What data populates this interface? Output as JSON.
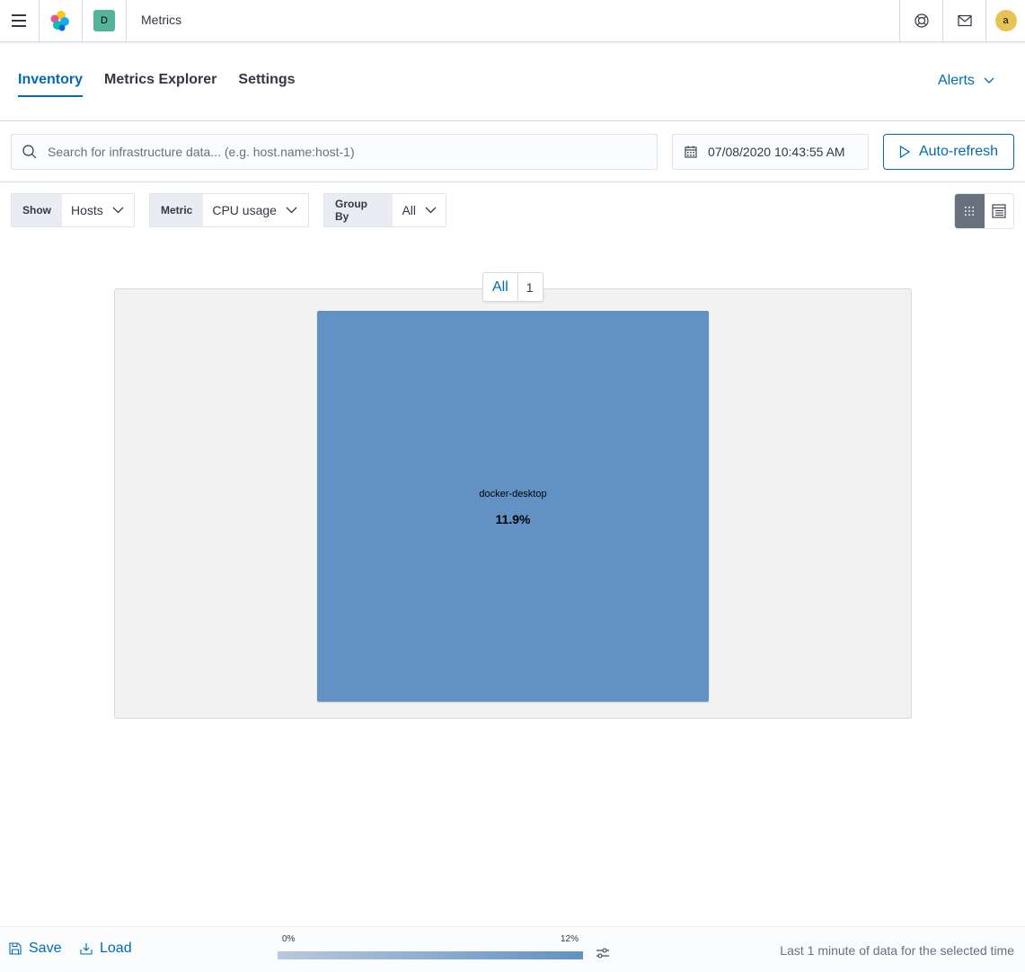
{
  "header": {
    "app_title": "Metrics",
    "space_initial": "D",
    "user_initial": "a",
    "icons": [
      "menu-icon",
      "elastic-logo",
      "help-icon",
      "mail-icon"
    ]
  },
  "tabs": [
    {
      "label": "Inventory",
      "active": true
    },
    {
      "label": "Metrics Explorer",
      "active": false
    },
    {
      "label": "Settings",
      "active": false
    }
  ],
  "alerts_label": "Alerts",
  "search": {
    "placeholder": "Search for infrastructure data... (e.g. host.name:host-1)",
    "value": ""
  },
  "datetime": "07/08/2020 10:43:55 AM",
  "auto_refresh_label": "Auto-refresh",
  "filters": {
    "show": {
      "label": "Show",
      "value": "Hosts"
    },
    "metric": {
      "label": "Metric",
      "value": "CPU usage"
    },
    "group_by": {
      "label": "Group By",
      "value": "All"
    }
  },
  "view_mode": {
    "selected": "map",
    "options": [
      "map",
      "table"
    ]
  },
  "waffle": {
    "group": {
      "name": "All",
      "count": "1"
    },
    "nodes": [
      {
        "name": "docker-desktop",
        "value": "11.9%",
        "color": "#6192c3"
      }
    ]
  },
  "bottom": {
    "save_label": "Save",
    "load_label": "Load",
    "legend_min": "0%",
    "legend_max": "12%",
    "legend_colors": [
      "#b8c8dd",
      "#6192c3"
    ],
    "status": "Last 1 minute of data for the selected time"
  },
  "colors": {
    "accent": "#006bb4",
    "text": "#343741"
  }
}
